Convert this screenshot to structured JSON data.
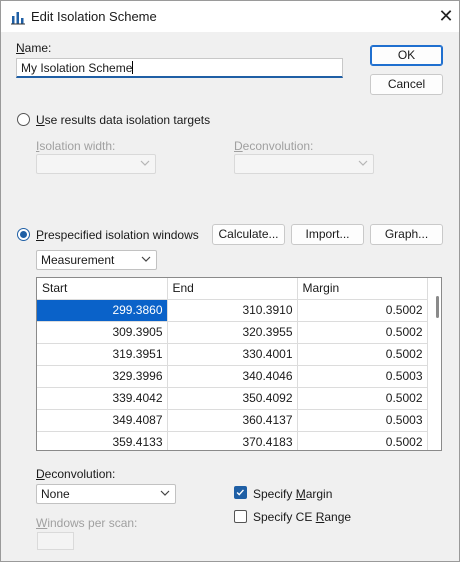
{
  "window": {
    "title": "Edit Isolation Scheme",
    "close_glyph": "✕"
  },
  "name_section": {
    "label": "Name:",
    "value": "My Isolation Scheme"
  },
  "buttons": {
    "ok": "OK",
    "cancel": "Cancel",
    "calculate": "Calculate...",
    "import": "Import...",
    "graph": "Graph..."
  },
  "results_option": {
    "label": "Use results data isolation targets",
    "selected": false,
    "isolation_width_label": "Isolation width:",
    "isolation_width_value": "",
    "deconvolution_label": "Deconvolution:",
    "deconvolution_value": ""
  },
  "prespecified_option": {
    "label": "Prespecified isolation windows",
    "selected": true,
    "mode_value": "Measurement"
  },
  "grid": {
    "columns": [
      "Start",
      "End",
      "Margin"
    ],
    "rows": [
      [
        "299.3860",
        "310.3910",
        "0.5002"
      ],
      [
        "309.3905",
        "320.3955",
        "0.5002"
      ],
      [
        "319.3951",
        "330.4001",
        "0.5002"
      ],
      [
        "329.3996",
        "340.4046",
        "0.5003"
      ],
      [
        "339.4042",
        "350.4092",
        "0.5002"
      ],
      [
        "349.4087",
        "360.4137",
        "0.5003"
      ],
      [
        "359.4133",
        "370.4183",
        "0.5002"
      ]
    ]
  },
  "bottom": {
    "deconvolution_label": "Deconvolution:",
    "deconvolution_value": "None",
    "windows_per_scan_label": "Windows per scan:",
    "specify_margin_label": "Specify Margin",
    "specify_margin_checked": true,
    "specify_ce_range_label": "Specify CE Range",
    "specify_ce_range_checked": false
  },
  "colors": {
    "accent": "#1f5fa5",
    "selection": "#0a62c9"
  }
}
